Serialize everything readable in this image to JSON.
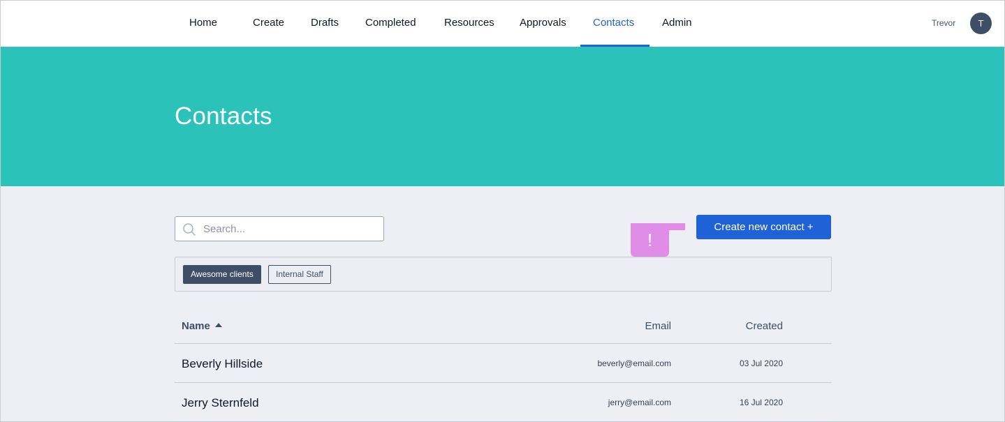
{
  "nav": {
    "items": [
      {
        "label": "Home"
      },
      {
        "label": "Create"
      },
      {
        "label": "Drafts"
      },
      {
        "label": "Completed"
      },
      {
        "label": "Resources"
      },
      {
        "label": "Approvals"
      },
      {
        "label": "Contacts",
        "active": true
      },
      {
        "label": "Admin"
      }
    ],
    "user_name": "Trevor",
    "avatar_initial": "T"
  },
  "hero": {
    "title": "Contacts"
  },
  "search": {
    "placeholder": "Search...",
    "value": ""
  },
  "actions": {
    "create_label": "Create new contact +"
  },
  "marker": {
    "label": "!"
  },
  "tags": [
    {
      "label": "Awesome clients",
      "selected": true
    },
    {
      "label": "Internal Staff",
      "selected": false
    }
  ],
  "table": {
    "headers": {
      "name": "Name",
      "email": "Email",
      "created": "Created"
    },
    "sort": {
      "column": "name",
      "direction": "ascending"
    },
    "rows": [
      {
        "name": "Beverly Hillside",
        "email": "beverly@email.com",
        "created": "03 Jul 2020"
      },
      {
        "name": "Jerry Sternfeld",
        "email": "jerry@email.com",
        "created": "16 Jul 2020"
      }
    ]
  },
  "colors": {
    "accent": "#1f62d8",
    "hero": "#2ac2b9",
    "tag_selected": "#3d4e66",
    "marker": "#e08de8",
    "background": "#edeff4"
  }
}
